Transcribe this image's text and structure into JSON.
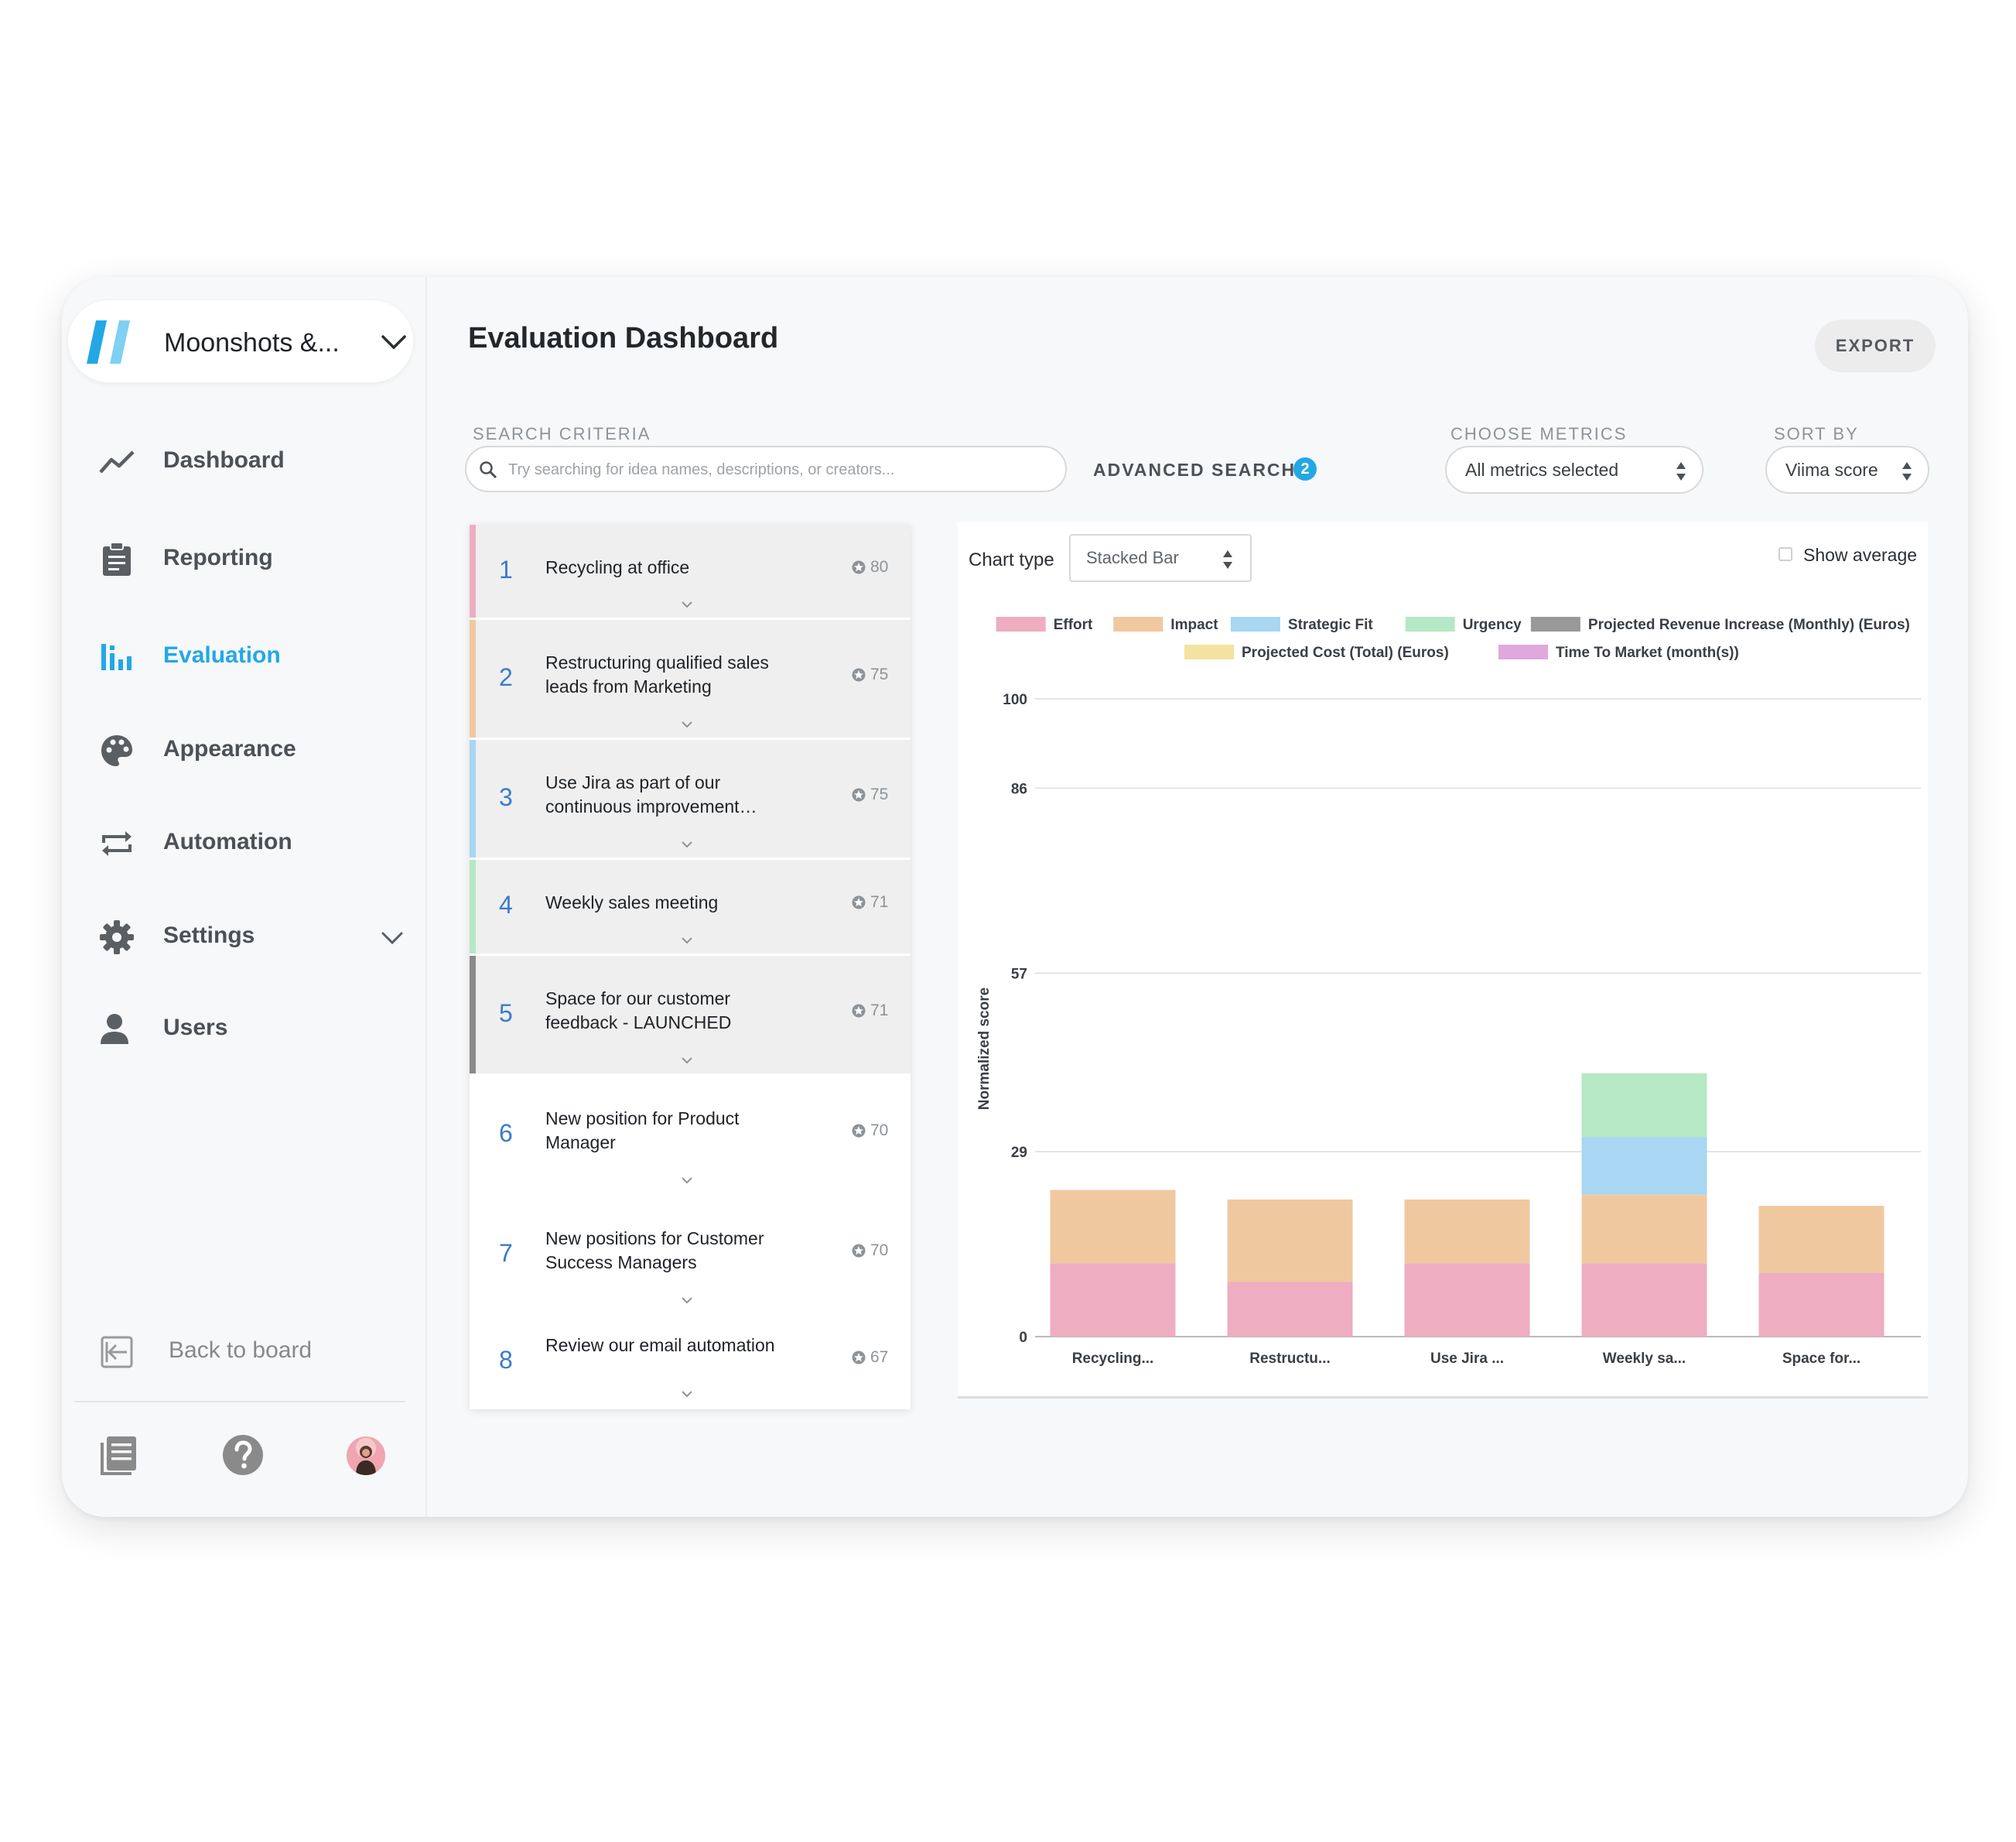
{
  "workspace": {
    "name": "Moonshots &..."
  },
  "nav": {
    "dashboard": "Dashboard",
    "reporting": "Reporting",
    "evaluation": "Evaluation",
    "appearance": "Appearance",
    "automation": "Automation",
    "settings": "Settings",
    "users": "Users",
    "back_to_board": "Back to board"
  },
  "colors": {
    "accent": "#23a8e5",
    "effort": "#eeadc1",
    "impact": "#f0c8a0",
    "strategic_fit": "#a8d6f3",
    "urgency": "#b5e8c5",
    "projected_revenue": "#999999",
    "projected_cost": "#f3e3a0",
    "time_to_market": "#e0a8dc"
  },
  "page": {
    "title": "Evaluation Dashboard",
    "export_label": "EXPORT"
  },
  "search": {
    "label": "SEARCH CRITERIA",
    "placeholder": "Try searching for idea names, descriptions, or creators...",
    "value": "",
    "advanced_label": "ADVANCED SEARCH",
    "advanced_count": "2"
  },
  "metrics": {
    "label": "CHOOSE METRICS",
    "selected": "All metrics selected"
  },
  "sort": {
    "label": "SORT BY",
    "selected": "Viima score"
  },
  "ideas": [
    {
      "rank": "1",
      "title": "Recycling at office",
      "score": "80",
      "color": "#eeadc1"
    },
    {
      "rank": "2",
      "title": "Restructuring qualified sales leads from Marketing",
      "score": "75",
      "color": "#f0c8a0"
    },
    {
      "rank": "3",
      "title": "Use Jira as part of our continuous improvement…",
      "score": "75",
      "color": "#a8d6f3"
    },
    {
      "rank": "4",
      "title": "Weekly sales meeting",
      "score": "71",
      "color": "#b5e8c5"
    },
    {
      "rank": "5",
      "title": "Space for our customer feedback - LAUNCHED",
      "score": "71",
      "color": "#8a8a8a"
    },
    {
      "rank": "6",
      "title": "New position for Product Manager",
      "score": "70",
      "color": ""
    },
    {
      "rank": "7",
      "title": "New positions for Customer Success Managers",
      "score": "70",
      "color": ""
    },
    {
      "rank": "8",
      "title": "Review our email automation",
      "score": "67",
      "color": ""
    }
  ],
  "chart_controls": {
    "chart_type_label": "Chart type",
    "chart_type_value": "Stacked Bar",
    "show_average_label": "Show average",
    "show_average_checked": false
  },
  "chart_data": {
    "type": "bar",
    "stacked": true,
    "title": "",
    "xlabel": "",
    "ylabel": "Normalized score",
    "ylim": [
      0,
      100
    ],
    "yticks": [
      0,
      29,
      57,
      86,
      100
    ],
    "grid": true,
    "legend_position": "top",
    "categories": [
      "Recycling...",
      "Restructu...",
      "Use Jira ...",
      "Weekly sa...",
      "Space for..."
    ],
    "series": [
      {
        "name": "Effort",
        "color": "#eeadc1",
        "values": [
          11.5,
          8.6,
          11.5,
          11.5,
          10
        ]
      },
      {
        "name": "Impact",
        "color": "#f0c8a0",
        "values": [
          11.5,
          12.9,
          10,
          10.8,
          10.5
        ]
      },
      {
        "name": "Strategic Fit",
        "color": "#a8d6f3",
        "values": [
          0,
          0,
          0,
          9,
          0
        ]
      },
      {
        "name": "Urgency",
        "color": "#b5e8c5",
        "values": [
          0,
          0,
          0,
          10,
          0
        ]
      },
      {
        "name": "Projected Revenue Increase (Monthly) (Euros)",
        "color": "#999999",
        "values": [
          0,
          0,
          0,
          0,
          0
        ]
      },
      {
        "name": "Projected Cost (Total) (Euros)",
        "color": "#f3e3a0",
        "values": [
          0,
          0,
          0,
          0,
          0
        ]
      },
      {
        "name": "Time To Market (month(s))",
        "color": "#e0a8dc",
        "values": [
          0,
          0,
          0,
          0,
          0
        ]
      }
    ]
  }
}
